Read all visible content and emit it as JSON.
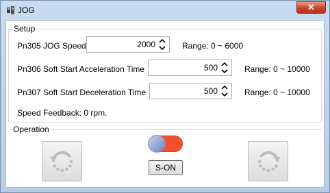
{
  "window": {
    "title": "JOG",
    "close_glyph": "✕",
    "icon": "jog-app-icon"
  },
  "setup": {
    "label": "Setup",
    "params": [
      {
        "label": "Pn305 JOG Speed",
        "value": "2000",
        "range": "Range:   0 ~ 6000"
      },
      {
        "label": "Pn306 Soft Start Acceleration Time",
        "value": "500",
        "range": "Range:    0 ~ 10000"
      },
      {
        "label": "Pn307 Soft Start Deceleration Time",
        "value": "500",
        "range": "Range:    0 ~ 10000"
      }
    ],
    "feedback": "Speed Feedback: 0 rpm."
  },
  "operation": {
    "label": "Operation",
    "son_label": "S-ON",
    "toggle_state": "off",
    "colors": {
      "toggle_track": "#f0502e",
      "toggle_knob": "#9fb0d6"
    }
  }
}
